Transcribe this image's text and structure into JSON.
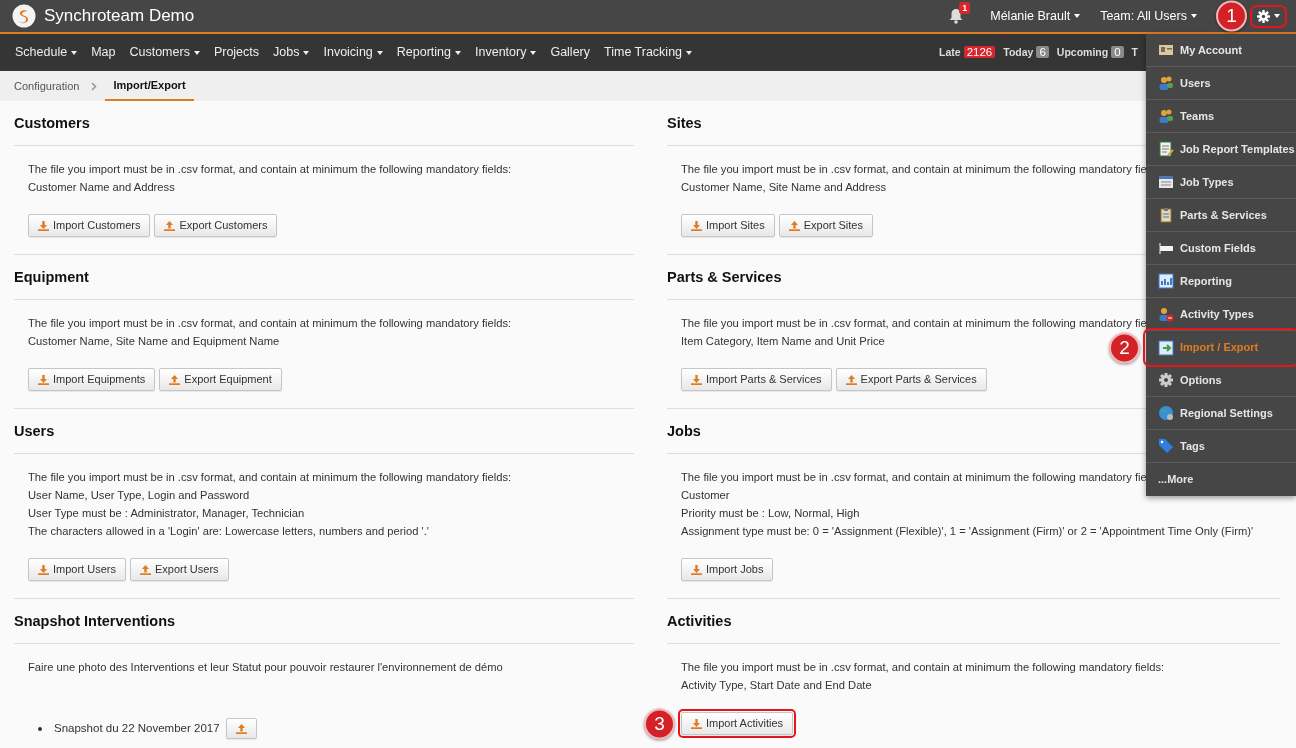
{
  "app": {
    "title": "Synchroteam Demo"
  },
  "topbar": {
    "notifications": {
      "count": "1"
    },
    "user": {
      "label": "Mélanie Brault",
      "dropdown": true
    },
    "team": {
      "label": "Team: All Users",
      "dropdown": true
    },
    "settings": {
      "callout": "1",
      "open": true
    }
  },
  "nav": [
    {
      "label": "Schedule",
      "dropdown": true
    },
    {
      "label": "Map",
      "dropdown": false
    },
    {
      "label": "Customers",
      "dropdown": true
    },
    {
      "label": "Projects",
      "dropdown": false
    },
    {
      "label": "Jobs",
      "dropdown": true
    },
    {
      "label": "Invoicing",
      "dropdown": true
    },
    {
      "label": "Reporting",
      "dropdown": true
    },
    {
      "label": "Inventory",
      "dropdown": true
    },
    {
      "label": "Gallery",
      "dropdown": false
    },
    {
      "label": "Time Tracking",
      "dropdown": true
    }
  ],
  "counters": [
    {
      "label": "Late",
      "count": "2126",
      "color": "#d9262c"
    },
    {
      "label": "Today",
      "count": "6",
      "color": "#8a8a8a"
    },
    {
      "label": "Upcoming",
      "count": "0",
      "color": "#8a8a8a"
    },
    {
      "label": "T"
    }
  ],
  "breadcrumb": [
    {
      "label": "Configuration",
      "selected": false
    },
    {
      "label": "Import/Export",
      "selected": true
    }
  ],
  "section_rows": [
    [
      {
        "title": "Customers",
        "lines": [
          "The file you import must be in .csv format, and contain at minimum the following mandatory fields:",
          "Customer Name and Address"
        ],
        "buttons": [
          {
            "label": "Import Customers",
            "kind": "import"
          },
          {
            "label": "Export Customers",
            "kind": "export"
          }
        ]
      },
      {
        "title": "Sites",
        "lines": [
          "The file you import must be in .csv format, and contain at minimum the following mandatory fie",
          "Customer Name, Site Name and Address"
        ],
        "buttons": [
          {
            "label": "Import Sites",
            "kind": "import"
          },
          {
            "label": "Export Sites",
            "kind": "export"
          }
        ]
      }
    ],
    [
      {
        "title": "Equipment",
        "lines": [
          "The file you import must be in .csv format, and contain at minimum the following mandatory fields:",
          "Customer Name, Site Name and Equipment Name"
        ],
        "buttons": [
          {
            "label": "Import Equipments",
            "kind": "import"
          },
          {
            "label": "Export Equipment",
            "kind": "export"
          }
        ]
      },
      {
        "title": "Parts & Services",
        "lines": [
          "The file you import must be in .csv format, and contain at minimum the following mandatory fie",
          "Item Category, Item Name and Unit Price"
        ],
        "buttons": [
          {
            "label": "Import Parts & Services",
            "kind": "import"
          },
          {
            "label": "Export Parts & Services",
            "kind": "export"
          }
        ]
      }
    ],
    [
      {
        "title": "Users",
        "lines": [
          "The file you import must be in .csv format, and contain at minimum the following mandatory fields:",
          "User Name, User Type, Login and Password",
          "User Type must be : Administrator, Manager, Technician",
          "The characters allowed in a 'Login' are: Lowercase letters, numbers and period '.'"
        ],
        "buttons": [
          {
            "label": "Import Users",
            "kind": "import"
          },
          {
            "label": "Export Users",
            "kind": "export"
          }
        ]
      },
      {
        "title": "Jobs",
        "lines": [
          "The file you import must be in .csv format, and contain at minimum the following mandatory fie",
          "Customer",
          "Priority must be : Low, Normal, High",
          "Assignment type must be: 0 = 'Assignment (Flexible)', 1 = 'Assignment (Firm)' or 2 = 'Appointment Time Only (Firm)'"
        ],
        "buttons": [
          {
            "label": "Import Jobs",
            "kind": "import"
          }
        ]
      }
    ],
    [
      {
        "title": "Snapshot Interventions",
        "lines": [
          "Faire une photo des Interventions et leur Statut pour pouvoir restaurer l'environnement de démo"
        ],
        "snapshots": [
          {
            "label": "Snapshot du 22 November 2017"
          }
        ]
      },
      {
        "title": "Activities",
        "lines": [
          "The file you import must be in .csv format, and contain at minimum the following mandatory fields:",
          "Activity Type, Start Date and End Date"
        ],
        "buttons": [
          {
            "label": "Import Activities",
            "kind": "import",
            "callout": "3"
          }
        ]
      }
    ]
  ],
  "settings_menu": [
    {
      "label": "My Account",
      "kind": "account",
      "selected": false
    },
    {
      "label": "Users",
      "kind": "users",
      "selected": false
    },
    {
      "label": "Teams",
      "kind": "users",
      "selected": false
    },
    {
      "label": "Job Report Templates",
      "kind": "template",
      "selected": false
    },
    {
      "label": "Job Types",
      "kind": "types",
      "selected": false
    },
    {
      "label": "Parts & Services",
      "kind": "clipboard",
      "selected": false
    },
    {
      "label": "Custom Fields",
      "kind": "field",
      "selected": false
    },
    {
      "label": "Reporting",
      "kind": "chart",
      "selected": false
    },
    {
      "label": "Activity Types",
      "kind": "activity",
      "selected": false
    },
    {
      "label": "Import / Export",
      "kind": "import",
      "selected": true,
      "callout": "2"
    },
    {
      "label": "Options",
      "kind": "gear",
      "selected": false
    },
    {
      "label": "Regional Settings",
      "kind": "globe",
      "selected": false
    },
    {
      "label": "Tags",
      "kind": "tag",
      "selected": false
    },
    {
      "label": "...More",
      "kind": "more",
      "selected": false
    }
  ]
}
